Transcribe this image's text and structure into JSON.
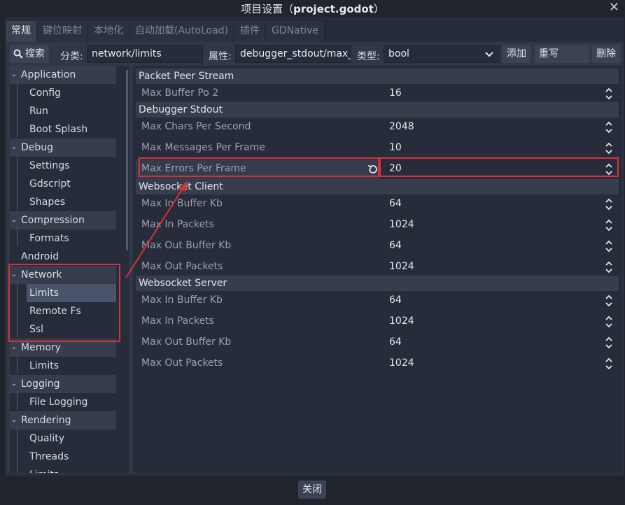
{
  "window": {
    "title_prefix": "项目设置（",
    "title_project": "project.godot",
    "title_suffix": "）",
    "close_glyph": "✕"
  },
  "tabs": [
    {
      "label": "常规",
      "active": true
    },
    {
      "label": "键位映射"
    },
    {
      "label": "本地化"
    },
    {
      "label": "自动加载(AutoLoad)"
    },
    {
      "label": "插件"
    },
    {
      "label": "GDNative"
    }
  ],
  "toolbar": {
    "search_label": "搜索",
    "category_label": "分类:",
    "category_value": "network/limits",
    "property_label": "属性:",
    "property_value": "debugger_stdout/max_",
    "type_label": "类型:",
    "type_value": "bool",
    "add_label": "添加",
    "override_label": "重写的......",
    "delete_label": "删除"
  },
  "tree": [
    {
      "label": "Application",
      "kind": "cat"
    },
    {
      "label": "Config"
    },
    {
      "label": "Run"
    },
    {
      "label": "Boot Splash"
    },
    {
      "label": "Debug",
      "kind": "cat"
    },
    {
      "label": "Settings"
    },
    {
      "label": "Gdscript"
    },
    {
      "label": "Shapes"
    },
    {
      "label": "Compression",
      "kind": "cat"
    },
    {
      "label": "Formats"
    },
    {
      "label": "Android",
      "kind": "leafcat"
    },
    {
      "label": "Network",
      "kind": "cat"
    },
    {
      "label": "Limits",
      "selected": true
    },
    {
      "label": "Remote Fs"
    },
    {
      "label": "Ssl"
    },
    {
      "label": "Memory",
      "kind": "cat"
    },
    {
      "label": "Limits"
    },
    {
      "label": "Logging",
      "kind": "cat"
    },
    {
      "label": "File Logging"
    },
    {
      "label": "Rendering",
      "kind": "cat"
    },
    {
      "label": "Quality"
    },
    {
      "label": "Threads"
    },
    {
      "label": "Limits"
    }
  ],
  "inspector": {
    "sections": [
      {
        "title": "Packet Peer Stream",
        "props": [
          {
            "name": "Max Buffer Po 2",
            "value": "16"
          }
        ]
      },
      {
        "title": "Debugger Stdout",
        "props": [
          {
            "name": "Max Chars Per Second",
            "value": "2048"
          },
          {
            "name": "Max Messages Per Frame",
            "value": "10"
          },
          {
            "name": "Max Errors Per Frame",
            "value": "20",
            "highlighted": true
          }
        ]
      },
      {
        "title": "Websocket Client",
        "props": [
          {
            "name": "Max In Buffer Kb",
            "value": "64"
          },
          {
            "name": "Max In Packets",
            "value": "1024"
          },
          {
            "name": "Max Out Buffer Kb",
            "value": "64"
          },
          {
            "name": "Max Out Packets",
            "value": "1024"
          }
        ]
      },
      {
        "title": "Websocket Server",
        "props": [
          {
            "name": "Max In Buffer Kb",
            "value": "64"
          },
          {
            "name": "Max In Packets",
            "value": "1024"
          },
          {
            "name": "Max Out Buffer Kb",
            "value": "64"
          },
          {
            "name": "Max Out Packets",
            "value": "1024"
          }
        ]
      }
    ]
  },
  "footer": {
    "close_label": "关闭"
  },
  "colors": {
    "annotation_red": "#d8303a",
    "accent": "#49536a"
  }
}
